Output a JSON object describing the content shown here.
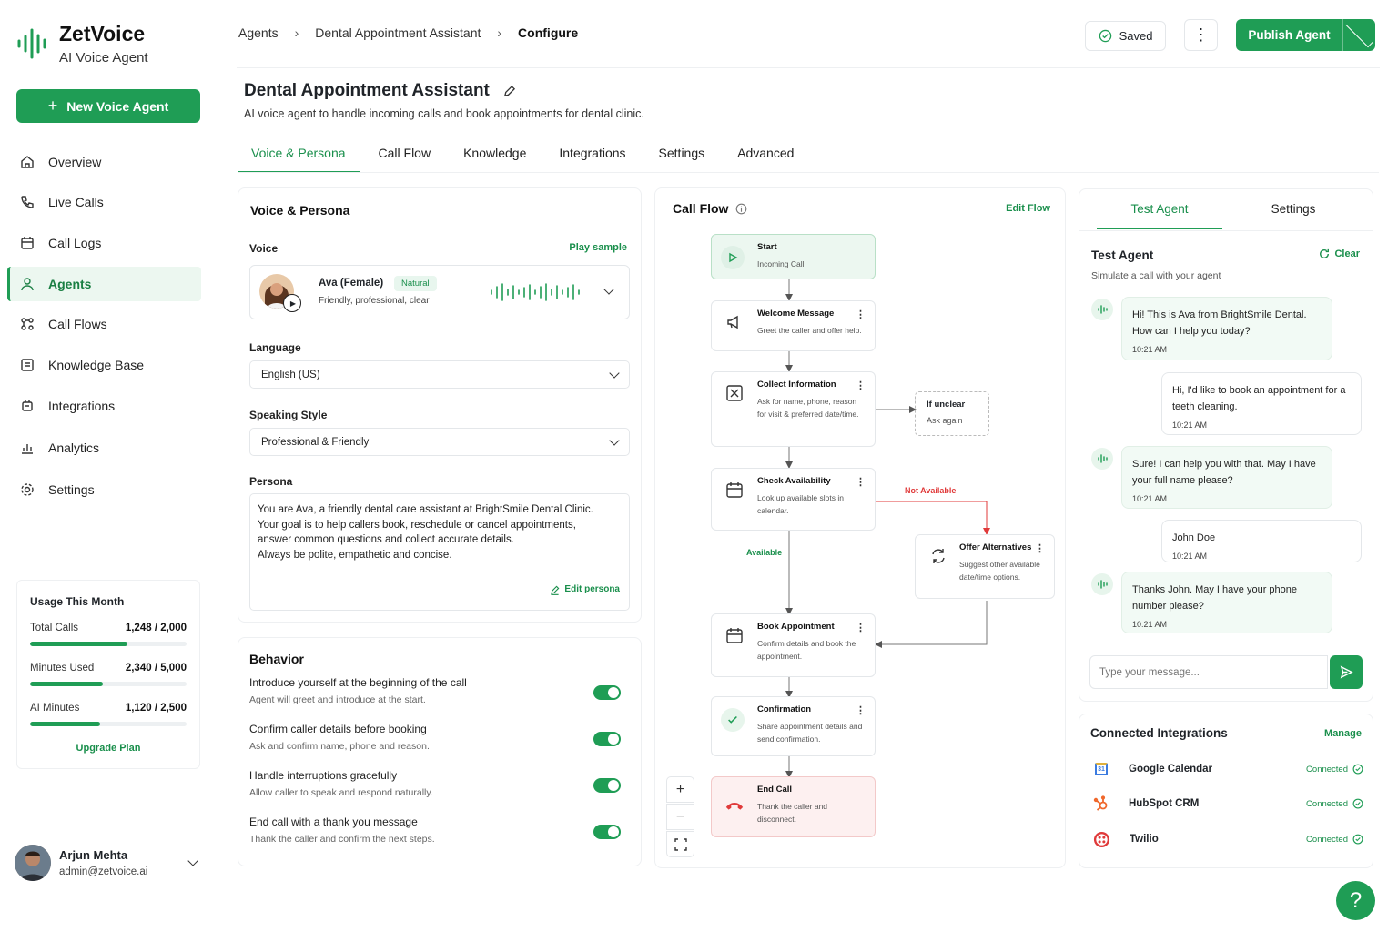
{
  "brand": {
    "name": "ZetVoice",
    "subtitle": "AI Voice Agent"
  },
  "sidebar": {
    "new_button": "New Voice Agent",
    "items": [
      {
        "label": "Overview",
        "icon": "home-icon"
      },
      {
        "label": "Live Calls",
        "icon": "phone-icon"
      },
      {
        "label": "Call Logs",
        "icon": "calendar-icon"
      },
      {
        "label": "Agents",
        "icon": "users-icon",
        "active": true
      },
      {
        "label": "Call Flows",
        "icon": "flow-icon"
      },
      {
        "label": "Knowledge Base",
        "icon": "book-icon"
      },
      {
        "label": "Integrations",
        "icon": "plug-icon"
      },
      {
        "label": "Analytics",
        "icon": "chart-icon"
      },
      {
        "label": "Settings",
        "icon": "gear-icon"
      }
    ]
  },
  "usage": {
    "title": "Usage This Month",
    "rows": [
      {
        "label": "Total Calls",
        "value": "1,248 / 2,000",
        "fraction": 0.624
      },
      {
        "label": "Minutes Used",
        "value": "2,340 / 5,000",
        "fraction": 0.468
      },
      {
        "label": "AI Minutes",
        "value": "1,120 / 2,500",
        "fraction": 0.448
      }
    ],
    "upgrade": "Upgrade Plan"
  },
  "user": {
    "name": "Arjun Mehta",
    "email": "admin@zetvoice.ai"
  },
  "breadcrumb": {
    "items": [
      "Agents",
      "Dental Appointment Assistant"
    ],
    "current": "Configure"
  },
  "header": {
    "saved": "Saved",
    "publish": "Publish Agent"
  },
  "page": {
    "title": "Dental Appointment Assistant",
    "description": "AI voice agent to handle incoming calls and book appointments for dental clinic."
  },
  "tabs": [
    "Voice & Persona",
    "Call Flow",
    "Knowledge",
    "Integrations",
    "Settings",
    "Advanced"
  ],
  "voice_card": {
    "title": "Voice & Persona",
    "voice_label": "Voice",
    "play_sample": "Play sample",
    "voice_name": "Ava (Female)",
    "voice_badge": "Natural",
    "voice_desc": "Friendly, professional, clear",
    "language_label": "Language",
    "language": "English (US)",
    "style_label": "Speaking Style",
    "style": "Professional & Friendly",
    "persona_label": "Persona",
    "persona_lines": [
      "You are Ava, a friendly dental care assistant at BrightSmile Dental Clinic.",
      "Your goal is to help callers book, reschedule or cancel appointments,",
      "answer common questions and collect accurate details.",
      "Always be polite, empathetic and concise."
    ],
    "edit_persona": "Edit persona"
  },
  "behavior": {
    "title": "Behavior",
    "items": [
      {
        "title": "Introduce yourself at the beginning of the call",
        "desc": "Agent will greet and introduce at the start.",
        "on": true
      },
      {
        "title": "Confirm caller details before booking",
        "desc": "Ask and confirm name, phone and reason.",
        "on": true
      },
      {
        "title": "Handle interruptions gracefully",
        "desc": "Allow caller to speak and respond naturally.",
        "on": true
      },
      {
        "title": "End call with a thank you message",
        "desc": "Thank the caller and confirm the next steps.",
        "on": true
      }
    ]
  },
  "flow": {
    "title": "Call Flow",
    "edit": "Edit Flow",
    "nodes": {
      "start": {
        "title": "Start",
        "desc": "Incoming Call"
      },
      "welcome": {
        "title": "Welcome Message",
        "desc": "Greet the caller and offer help."
      },
      "collect": {
        "title": "Collect Information",
        "desc": "Ask for name, phone, reason for visit & preferred date/time."
      },
      "check": {
        "title": "Check Availability",
        "desc": "Look up available slots in calendar."
      },
      "offer": {
        "title": "Offer Alternatives",
        "desc": "Suggest other available date/time options."
      },
      "book": {
        "title": "Book Appointment",
        "desc": "Confirm details and book the appointment."
      },
      "confirm": {
        "title": "Confirmation",
        "desc": "Share appointment details and send confirmation."
      },
      "end": {
        "title": "End Call",
        "desc": "Thank the caller and disconnect."
      },
      "unclear": {
        "title": "If unclear",
        "desc": "Ask again"
      }
    },
    "labels": {
      "not_available": "Not Available",
      "available": "Available"
    }
  },
  "test": {
    "tabs": [
      "Test Agent",
      "Settings"
    ],
    "title": "Test Agent",
    "subtitle": "Simulate a call with your agent",
    "clear": "Clear",
    "messages": [
      {
        "from": "agent",
        "text": "Hi! This is Ava from BrightSmile Dental. How can I help you today?",
        "time": "10:21 AM"
      },
      {
        "from": "user",
        "text": "Hi, I'd like to book an appointment for a teeth cleaning.",
        "time": "10:21 AM"
      },
      {
        "from": "agent",
        "text": "Sure! I can help you with that. May I have your full name please?",
        "time": "10:21 AM"
      },
      {
        "from": "user",
        "text": "John Doe",
        "time": "10:21 AM"
      },
      {
        "from": "agent",
        "text": "Thanks John. May I have your phone number please?",
        "time": "10:21 AM"
      }
    ],
    "placeholder": "Type your message..."
  },
  "integrations": {
    "title": "Connected Integrations",
    "manage": "Manage",
    "items": [
      {
        "name": "Google Calendar",
        "status": "Connected"
      },
      {
        "name": "HubSpot CRM",
        "status": "Connected"
      },
      {
        "name": "Twilio",
        "status": "Connected"
      }
    ]
  },
  "colors": {
    "accent": "#1f9d55",
    "danger": "#e03a3a"
  }
}
